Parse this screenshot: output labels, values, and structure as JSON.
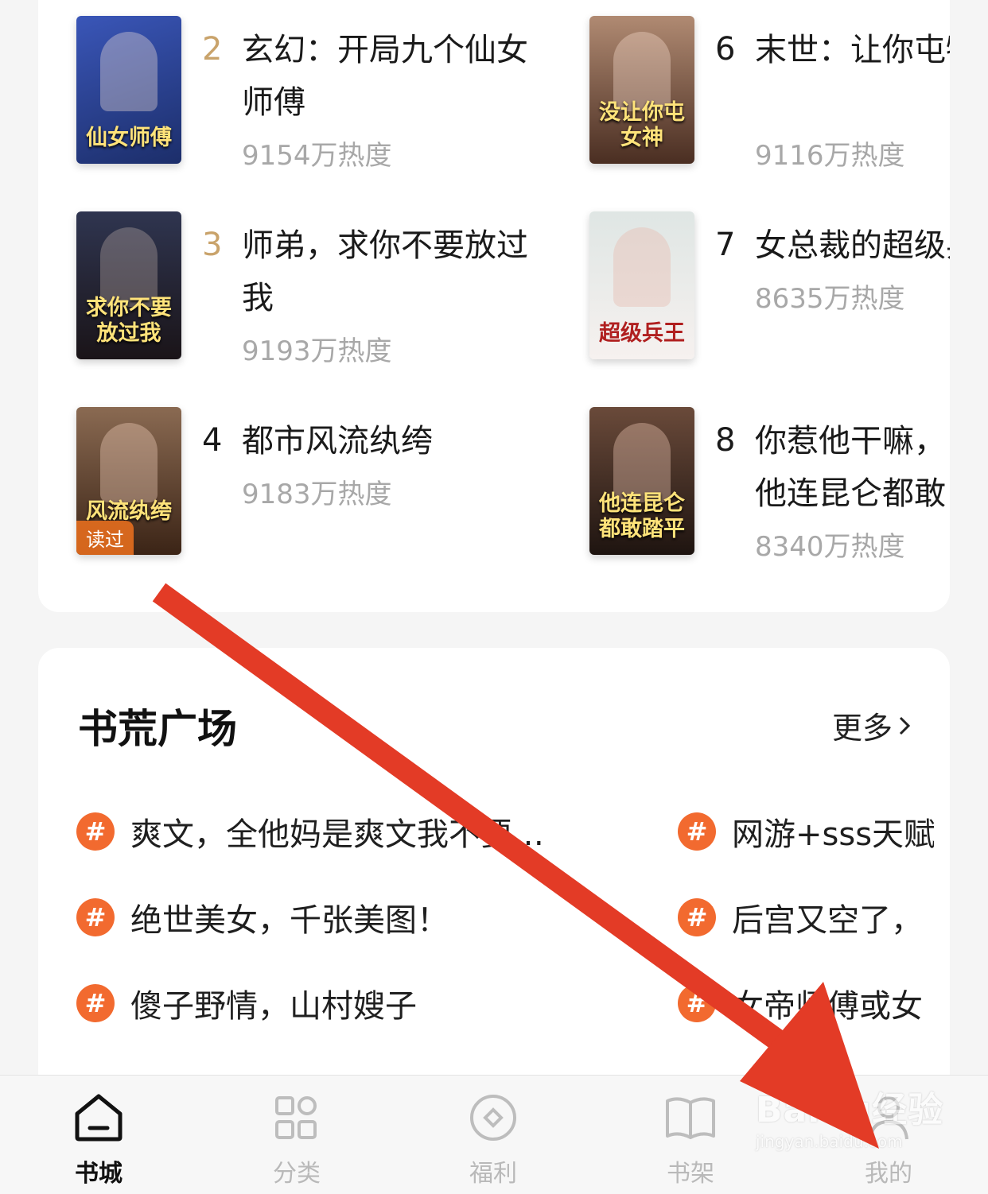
{
  "ranking": {
    "books": [
      {
        "rank": "2",
        "title": "玄幻：开局九个仙女师傅",
        "heat": "9154万热度",
        "cover_text": "仙女师傅",
        "cover_color": "#27408f"
      },
      {
        "rank": "3",
        "title": "师弟，求你不要放过我",
        "heat": "9193万热度",
        "cover_text": "求你不要放过我",
        "cover_color": "#2a2a3a"
      },
      {
        "rank": "4",
        "title": "都市风流纨绔",
        "heat": "9183万热度",
        "cover_text": "风流纨绔",
        "cover_color": "#5b3a22",
        "cover_tag": "读过"
      },
      {
        "rank": "6",
        "title": "末世：让你屯物资，没让你屯女神",
        "heat": "9116万热度",
        "cover_text": "没让你屯女神",
        "cover_color": "#6b4a38"
      },
      {
        "rank": "7",
        "title": "女总裁的超级兵王",
        "heat": "8635万热度",
        "cover_text": "超级兵王",
        "cover_color": "#e9e4e0"
      },
      {
        "rank": "8",
        "title": "你惹他干嘛，他连昆仑都敢踏平",
        "heat": "8340万热度",
        "cover_text": "他连昆仑都敢踏平",
        "cover_color": "#3a2a25"
      }
    ]
  },
  "square": {
    "title": "书荒广场",
    "more_label": "更多",
    "hash_symbol": "#",
    "topics_left": [
      "爽文，全他妈是爽文我不要…",
      "绝世美女，千张美图！",
      "傻子野情，山村嫂子"
    ],
    "topics_right": [
      "网游+sss天赋",
      "后宫又空了，",
      "女帝师傅或女"
    ]
  },
  "tabbar": {
    "tabs": [
      {
        "label": "书城",
        "icon": "home-icon"
      },
      {
        "label": "分类",
        "icon": "grid-icon"
      },
      {
        "label": "福利",
        "icon": "diamond-circle-icon"
      },
      {
        "label": "书架",
        "icon": "book-icon"
      },
      {
        "label": "我的",
        "icon": "user-icon"
      }
    ]
  },
  "watermark": {
    "text": "Baidu经验",
    "sub": "jingyan.baidu.com"
  },
  "colors": {
    "accent": "#f26a2f",
    "rank_gold": "#c9a36b",
    "arrow": "#e33b26",
    "heat": "#a8a8a8"
  }
}
